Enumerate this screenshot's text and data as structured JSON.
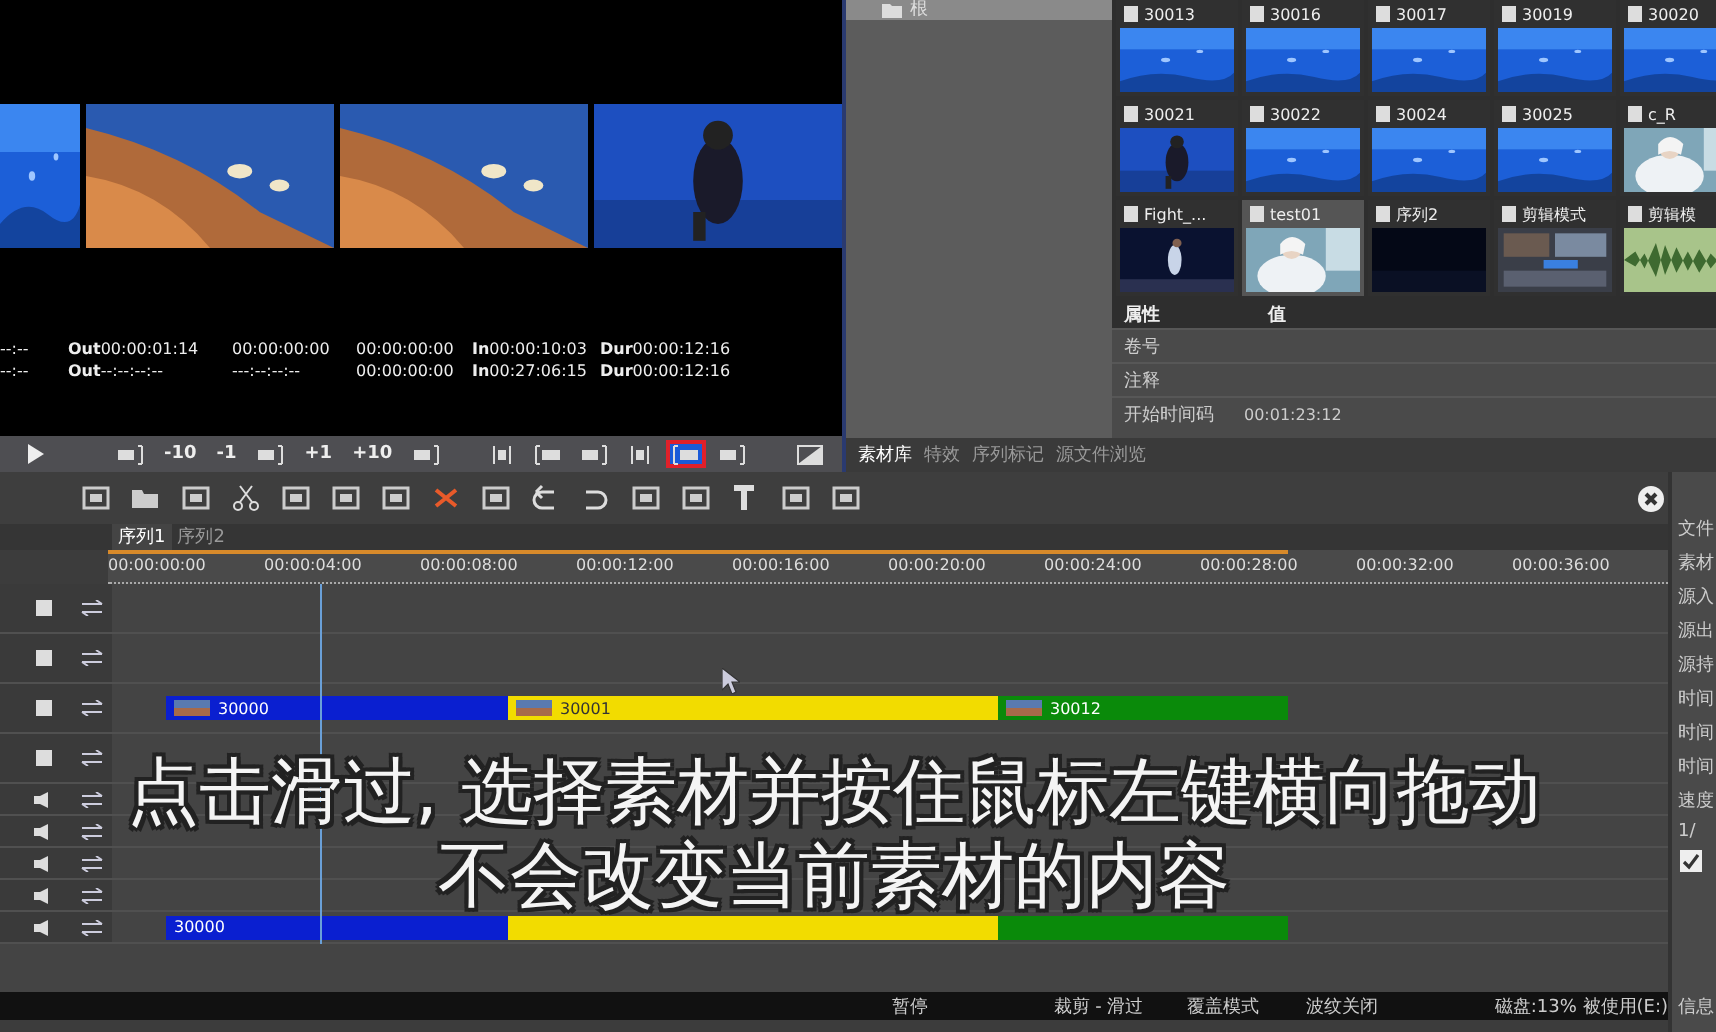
{
  "preview": {
    "timecodes": [
      [
        {
          "value": "--:--"
        },
        {
          "label": "Out",
          "value": "00:00:01:14"
        },
        {
          "value": "00:00:00:00"
        },
        {
          "value": "00:00:00:00"
        },
        {
          "label": "In",
          "value": "00:00:10:03"
        },
        {
          "label": "Dur",
          "value": "00:00:12:16"
        }
      ],
      [
        {
          "value": "--:--"
        },
        {
          "label": "Out",
          "value": "--:--:--:--"
        },
        {
          "value": "---:--:--:--"
        },
        {
          "value": "00:00:00:00"
        },
        {
          "label": "In",
          "value": "00:27:06:15"
        },
        {
          "label": "Dur",
          "value": "00:00:12:16"
        }
      ]
    ],
    "transport": [
      [
        {
          "kind": "play",
          "selected": false,
          "annotated": false
        }
      ],
      [
        {
          "kind": "icon",
          "selected": false,
          "annotated": false
        },
        {
          "kind": "text",
          "label": "-10",
          "selected": false,
          "annotated": false
        },
        {
          "kind": "text",
          "label": "-1",
          "selected": false,
          "annotated": false
        },
        {
          "kind": "icon",
          "selected": false,
          "annotated": false
        },
        {
          "kind": "text",
          "label": "+1",
          "selected": false,
          "annotated": false
        },
        {
          "kind": "text",
          "label": "+10",
          "selected": false,
          "annotated": false
        },
        {
          "kind": "icon",
          "selected": false,
          "annotated": false
        }
      ],
      [
        {
          "kind": "icon",
          "selected": false,
          "annotated": false
        },
        {
          "kind": "icon",
          "selected": false,
          "annotated": false
        },
        {
          "kind": "icon",
          "selected": false,
          "annotated": false
        },
        {
          "kind": "icon",
          "selected": false,
          "annotated": false
        },
        {
          "kind": "icon",
          "selected": true,
          "annotated": true
        },
        {
          "kind": "icon",
          "selected": false,
          "annotated": false
        }
      ],
      [
        {
          "kind": "icon",
          "selected": false,
          "annotated": false
        }
      ]
    ]
  },
  "bin": {
    "tree": [
      {
        "label": "根",
        "selected": true
      }
    ],
    "clips": [
      {
        "label": "30013",
        "selected": false
      },
      {
        "label": "30016",
        "selected": false
      },
      {
        "label": "30017",
        "selected": false
      },
      {
        "label": "30019",
        "selected": false
      },
      {
        "label": "30020",
        "selected": false
      },
      {
        "label": "30021",
        "selected": false
      },
      {
        "label": "30022",
        "selected": false
      },
      {
        "label": "30024",
        "selected": false
      },
      {
        "label": "30025",
        "selected": false
      },
      {
        "label": "c_R",
        "selected": false
      },
      {
        "label": "Fight_...",
        "selected": false
      },
      {
        "label": "test01",
        "selected": true
      },
      {
        "label": "序列2",
        "selected": false
      },
      {
        "label": "剪辑模式",
        "selected": false
      },
      {
        "label": "剪辑模",
        "selected": false
      }
    ],
    "properties": {
      "columns": [
        "属性",
        "值"
      ],
      "rows": [
        {
          "name": "卷号"
        },
        {
          "name": "注释"
        },
        {
          "name": "开始时间码",
          "value": "00:01:23:12"
        }
      ]
    },
    "tabs": [
      {
        "label": "素材库",
        "selected": true
      },
      {
        "label": "特效",
        "selected": false
      },
      {
        "label": "序列标记",
        "selected": false
      },
      {
        "label": "源文件浏览",
        "selected": false
      }
    ]
  },
  "timeline": {
    "sequence_tabs": [
      {
        "label": "序列1",
        "selected": true
      },
      {
        "label": "序列2",
        "selected": false
      }
    ],
    "ruler": [
      "00:00:00:00",
      "00:00:04:00",
      "00:00:08:00",
      "00:00:12:00",
      "00:00:16:00",
      "00:00:20:00",
      "00:00:24:00",
      "00:00:28:00",
      "00:00:32:00",
      "00:00:36:00"
    ],
    "tracks": [
      {
        "kind": "video"
      },
      {
        "kind": "video"
      },
      {
        "kind": "video",
        "clips": [
          {
            "name": "30000",
            "color": "#0a1fd0"
          },
          {
            "name": "30001",
            "color": "#f2dc00"
          },
          {
            "name": "30012",
            "color": "#0a8a0a"
          }
        ]
      },
      {
        "kind": "video"
      },
      {
        "kind": "audio"
      },
      {
        "kind": "audio"
      },
      {
        "kind": "audio"
      },
      {
        "kind": "audio"
      },
      {
        "kind": "audio",
        "clips": [
          {
            "name": "30000",
            "color": "#0a1fd0"
          },
          {
            "color": "#f2dc00"
          },
          {
            "color": "#0a8a0a"
          }
        ]
      }
    ]
  },
  "caption": [
    "点击滑过, 选择素材并按住鼠标左键横向拖动",
    "不会改变当前素材的内容"
  ],
  "status_bar": [
    "暂停",
    "裁剪 - 滑过",
    "覆盖模式",
    "波纹关闭",
    "磁盘:13% 被使用(E:)"
  ],
  "side_panel": {
    "labels": [
      "文件",
      "素材",
      "源入",
      "源出",
      "源持",
      "时间",
      "时间",
      "时间",
      "速度"
    ],
    "fraction": "1/",
    "checked": true,
    "footer": "信息"
  }
}
